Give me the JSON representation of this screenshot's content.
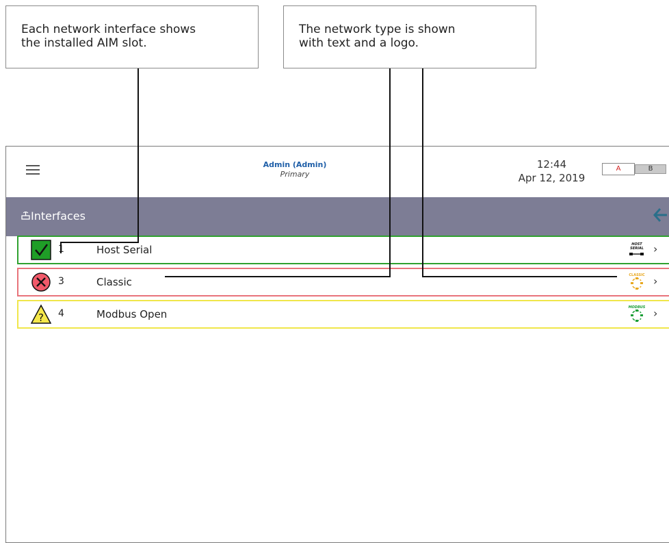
{
  "callouts": [
    {
      "lines": [
        "Each network interface shows",
        "the installed AIM slot."
      ]
    },
    {
      "lines": [
        "The network type is shown",
        "with text and a logo."
      ]
    }
  ],
  "header": {
    "user": "Admin (Admin)",
    "role": "Primary",
    "time": "12:44",
    "date": "Apr 12, 2019",
    "toggle_a": "A",
    "toggle_b": "B"
  },
  "titlebar": {
    "title": "Interfaces",
    "icon": "network-icon",
    "back_icon": "back-arrow-icon"
  },
  "interfaces": [
    {
      "slot": "1",
      "name": "Host Serial",
      "status": "ok",
      "logo_text": "HOST\nSERIAL",
      "border": "#2fa12f"
    },
    {
      "slot": "3",
      "name": "Classic",
      "status": "error",
      "logo_text": "CLASSIC",
      "border": "#e8737a"
    },
    {
      "slot": "4",
      "name": "Modbus Open",
      "status": "warning",
      "logo_text": "MODBUS",
      "border": "#f0e64a"
    }
  ],
  "colors": {
    "titlebar": "#7d7d95",
    "ok": "#2fa12f",
    "error": "#e8737a",
    "warning": "#f0e64a",
    "user": "#1f5fa8"
  }
}
